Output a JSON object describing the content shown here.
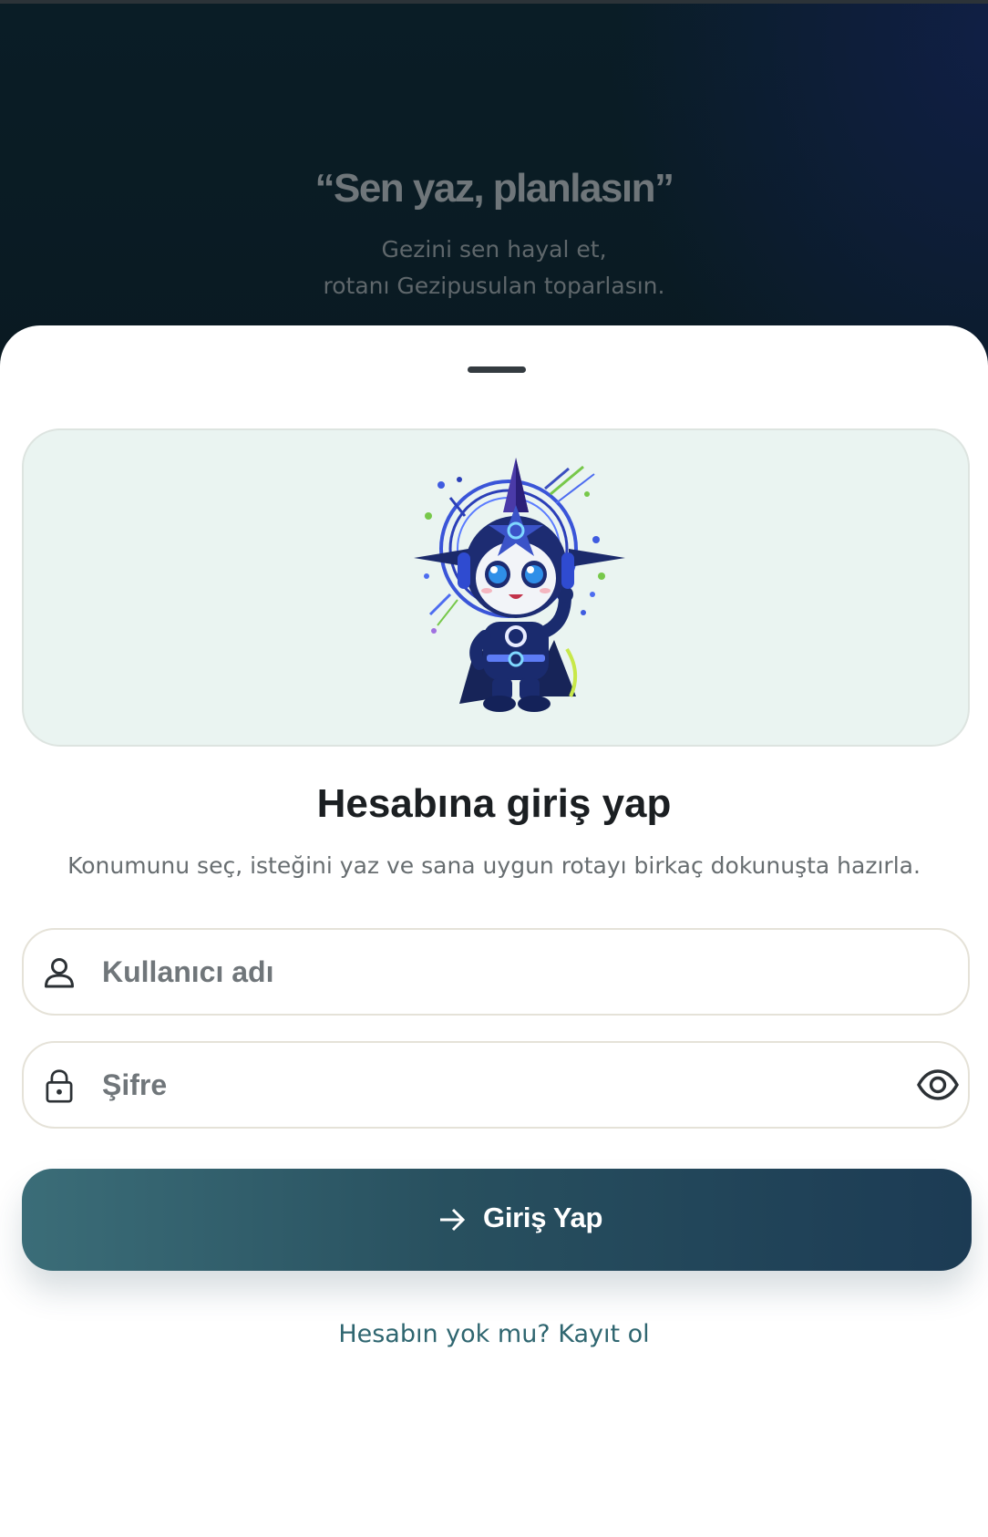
{
  "hero": {
    "quote": "“Sen yaz, planlasın”",
    "subtitle_line1": "Gezini sen hayal et,",
    "subtitle_line2": "rotanı Gezipusulan toparlasın."
  },
  "mascot": {
    "icon": "compass-mascot-illustration"
  },
  "login": {
    "title": "Hesabına giriş yap",
    "subtitle": "Konumunu seç, isteğini yaz ve sana uygun rotayı birkaç dokunuşta hazırla.",
    "username": {
      "placeholder": "Kullanıcı adı",
      "value": "",
      "icon": "user-icon"
    },
    "password": {
      "placeholder": "Şifre",
      "value": "",
      "icon": "lock-icon",
      "toggle_icon": "eye-icon"
    },
    "submit_label": "Giriş Yap",
    "submit_icon": "arrow-right-icon",
    "register_link": "Hesabın yok mu? Kayıt ol"
  },
  "colors": {
    "hero_background": "#0a1d26",
    "sheet_background": "#ffffff",
    "card_background": "#eaf4f1",
    "button_gradient_start": "#3b6d78",
    "button_gradient_end": "#1c3b54",
    "link_color": "#2f6670",
    "title_color": "#1b1f22"
  }
}
